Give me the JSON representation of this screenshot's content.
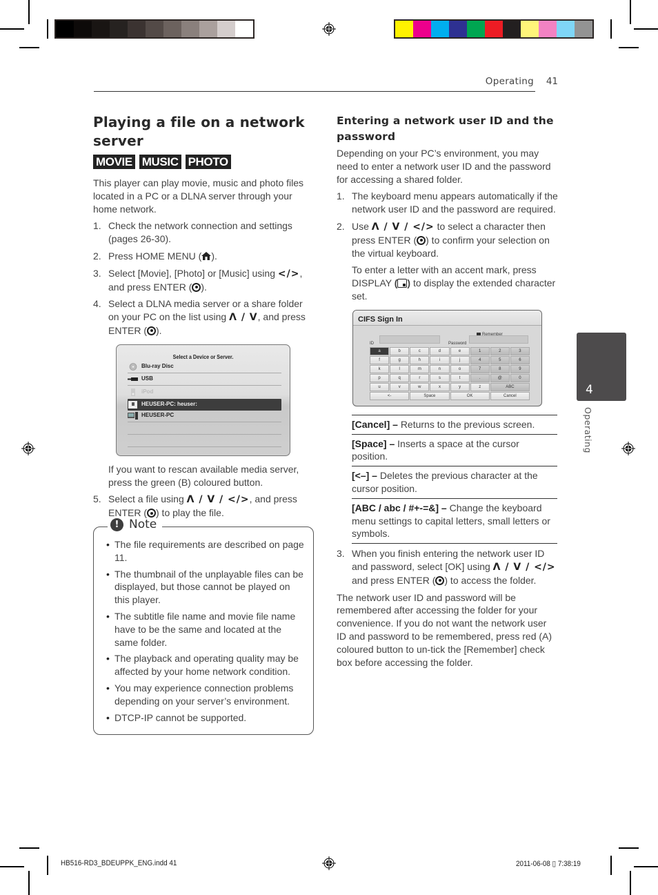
{
  "header": {
    "section": "Operating",
    "page_number": "41"
  },
  "print_marks": {
    "grayscale_swatches": [
      "#000000",
      "#0d0a09",
      "#191513",
      "#262220",
      "#3b3331",
      "#534a47",
      "#6c625e",
      "#8a807c",
      "#aaa09d",
      "#d4cdcc",
      "#ffffff"
    ],
    "color_swatches": [
      "#fff200",
      "#ec008c",
      "#00aeef",
      "#2e3192",
      "#00a651",
      "#ed1c24",
      "#231f20",
      "#fff57a",
      "#f282c3",
      "#7fd6f7",
      "#939393"
    ]
  },
  "left": {
    "title": "Playing a file on a network server",
    "badges": [
      "MOVIE",
      "MUSIC",
      "PHOTO"
    ],
    "intro": "This player can play movie, music and photo files located in a PC or a DLNA server through your home network.",
    "steps": [
      {
        "num": "1.",
        "text": "Check the network connection and settings (pages 26-30)."
      },
      {
        "num": "2.",
        "pre": "Press HOME MENU (",
        "post": ")."
      },
      {
        "num": "3.",
        "pre": "Select [Movie], [Photo] or [Music] using ",
        "sym": "</>",
        "mid": ", and press ENTER (",
        "post": ")."
      },
      {
        "num": "4.",
        "pre": "Select a DLNA media server or a share folder on your PC on the list using ",
        "sym": "Λ / V",
        "mid": ", and press ENTER (",
        "post": ")."
      },
      {
        "num": "5.",
        "pre": "Select a file using ",
        "sym": "Λ / V / </>",
        "mid": ", and press ENTER (",
        "post": ") to play the file."
      }
    ],
    "device_screen": {
      "title": "Select a Device or Server.",
      "items": [
        {
          "label": "Blu-ray Disc",
          "icon": "disc-icon",
          "state": "normal"
        },
        {
          "label": "USB",
          "icon": "usb-icon",
          "state": "normal"
        },
        {
          "label": "iPod",
          "icon": "ipod-icon",
          "state": "disabled"
        },
        {
          "label": "HEUSER-PC: heuser:",
          "icon": "dlna-server-icon",
          "state": "selected"
        },
        {
          "label": "HEUSER-PC",
          "icon": "pc-icon",
          "state": "normal"
        }
      ]
    },
    "rescan_note": "If you want to rescan available media server, press the green (B) coloured button.",
    "note": {
      "title": "Note",
      "items": [
        "The file requirements are described on page 11.",
        "The thumbnail of the unplayable files can be displayed, but those cannot be played on this player.",
        "The subtitle file name and movie file name have to be the same and located at the same folder.",
        "The playback and operating quality may be affected by your home network condition.",
        "You may experience connection problems depending on your server’s environment.",
        "DTCP-IP cannot be supported."
      ]
    }
  },
  "right": {
    "title": "Entering a network user ID and the password",
    "intro": "Depending on your PC’s environment, you may need to enter a network user ID and the password for accessing a shared folder.",
    "step1": {
      "num": "1.",
      "text": "The keyboard menu appears automatically if the network user ID and the password are required."
    },
    "step2": {
      "num": "2.",
      "pre": "Use ",
      "sym": "Λ / V / </>",
      "mid": " to select a character then press ENTER (",
      "post": ") to confirm your selection on the virtual keyboard."
    },
    "step2_extra": {
      "pre": "To enter a letter with an accent mark, press DISPLAY ",
      "post": " to display the extended character set."
    },
    "keyboard_screen": {
      "title": "CIFS Sign In",
      "remember_label": "Remember",
      "remember_checked": true,
      "id_label": "ID",
      "id_value": "",
      "password_label": "Password",
      "password_value": "",
      "keys": [
        [
          "a",
          "b",
          "c",
          "d",
          "e",
          "1",
          "2",
          "3"
        ],
        [
          "f",
          "g",
          "h",
          "i",
          "j",
          "4",
          "5",
          "6"
        ],
        [
          "k",
          "l",
          "m",
          "n",
          "o",
          "7",
          "8",
          "9"
        ],
        [
          "p",
          "q",
          "r",
          "s",
          "t",
          ".",
          "@",
          "0"
        ],
        [
          "u",
          "v",
          "w",
          "x",
          "y",
          "z",
          "ABC"
        ]
      ],
      "bottom_keys": [
        "<-",
        "Space",
        "OK",
        "Cancel"
      ],
      "selected_key": "a"
    },
    "definitions": [
      {
        "term": "[Cancel]",
        "dash": " – ",
        "desc": "Returns to the previous screen."
      },
      {
        "term": "[Space]",
        "dash": " – ",
        "desc": "Inserts a space at the cursor position."
      },
      {
        "term": "[<–]",
        "dash": " – ",
        "desc": "Deletes the previous character at the cursor position."
      },
      {
        "term": "[ABC / abc / #+-=&]",
        "dash": " – ",
        "desc": "Change the keyboard menu settings to capital letters, small letters or symbols."
      }
    ],
    "step3": {
      "num": "3.",
      "pre": "When you finish entering the network user ID and password, select [OK] using ",
      "sym": "Λ / V / </>",
      "mid": " and press ENTER (",
      "post": ") to access the folder."
    },
    "closing": "The network user ID and password will be remembered after accessing the folder for your convenience. If you do not want the network user ID and password to be remembered, press red (A) coloured button to un-tick the [Remember] check box before accessing the folder."
  },
  "side_tab": {
    "chapter": "4",
    "label": "Operating"
  },
  "footer": {
    "file": "HB516-RD3_BDEUPPK_ENG.indd   41",
    "datetime": "2011-06-08   ▯ 7:38:19"
  }
}
